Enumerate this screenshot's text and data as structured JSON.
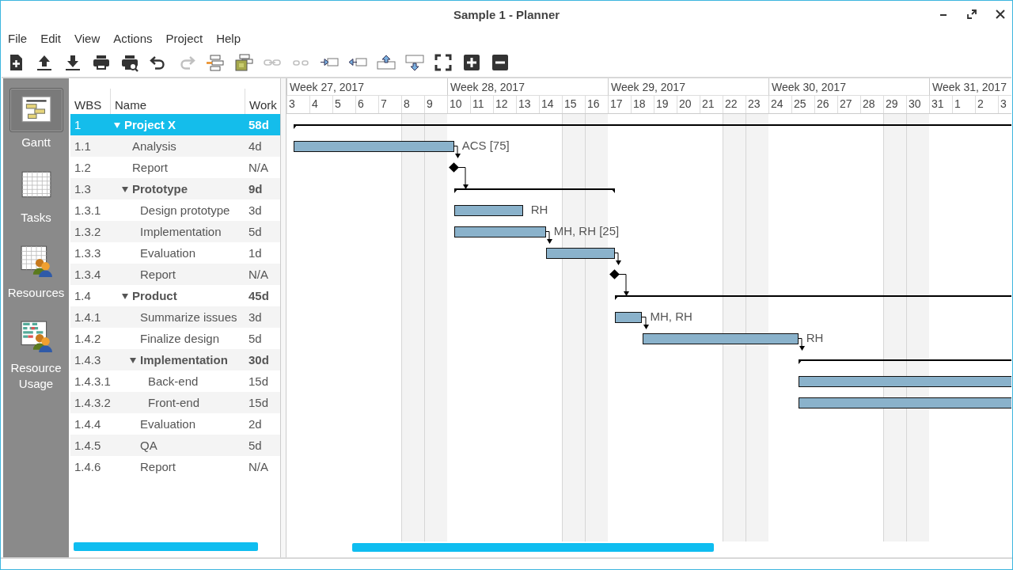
{
  "window": {
    "title": "Sample 1 - Planner"
  },
  "menu": [
    "File",
    "Edit",
    "View",
    "Actions",
    "Project",
    "Help"
  ],
  "toolbar": {
    "groups": [
      [
        {
          "kind": "new",
          "disabled": false
        },
        {
          "kind": "upload",
          "disabled": false
        },
        {
          "kind": "download",
          "disabled": false
        }
      ],
      [
        {
          "kind": "print",
          "disabled": false
        },
        {
          "kind": "preview",
          "disabled": false
        }
      ],
      [
        {
          "kind": "undo",
          "disabled": false
        },
        {
          "kind": "redo",
          "disabled": true
        }
      ],
      [
        {
          "kind": "insert-task",
          "disabled": false
        },
        {
          "kind": "insert-package",
          "disabled": false
        }
      ],
      [
        {
          "kind": "link",
          "disabled": true
        },
        {
          "kind": "unlink",
          "disabled": true
        }
      ],
      [
        {
          "kind": "indent",
          "disabled": false
        },
        {
          "kind": "unindent",
          "disabled": false
        }
      ],
      [
        {
          "kind": "move-up",
          "disabled": false
        },
        {
          "kind": "move-down",
          "disabled": false
        }
      ],
      [
        {
          "kind": "fit",
          "disabled": false
        },
        {
          "kind": "zoom-in",
          "disabled": false
        },
        {
          "kind": "zoom-out",
          "disabled": false
        }
      ]
    ]
  },
  "sidebar": {
    "items": [
      {
        "kind": "gantt",
        "label": "Gantt",
        "selected": true
      },
      {
        "kind": "tasks",
        "label": "Tasks",
        "selected": false
      },
      {
        "kind": "resources",
        "label": "Resources",
        "selected": false
      },
      {
        "kind": "usage",
        "label": "Resource Usage",
        "selected": false
      }
    ]
  },
  "task_table": {
    "columns": [
      "WBS",
      "Name",
      "Work"
    ],
    "rows": [
      {
        "wbs": "1",
        "name": "Project X",
        "work": "58d",
        "selected": true,
        "expanded": true,
        "bar": {
          "kind": "summary"
        },
        "children": [
          {
            "wbs": "1.1",
            "name": "Analysis",
            "work": "4d",
            "selected": false,
            "bar": {
              "kind": "task",
              "label": "ACS [75]",
              "link": true
            }
          },
          {
            "wbs": "1.2",
            "name": "Report",
            "work": "N/A",
            "selected": false,
            "bar": {
              "kind": "milestone",
              "link": true
            }
          },
          {
            "wbs": "1.3",
            "name": "Prototype",
            "work": "9d",
            "selected": false,
            "expanded": true,
            "bar": {
              "kind": "summary"
            },
            "children": [
              {
                "wbs": "1.3.1",
                "name": "Design prototype",
                "work": "3d",
                "selected": false,
                "bar": {
                  "kind": "task",
                  "label": "RH"
                }
              },
              {
                "wbs": "1.3.2",
                "name": "Implementation",
                "work": "5d",
                "selected": false,
                "bar": {
                  "kind": "task",
                  "label": "MH, RH [25]",
                  "link": true
                }
              },
              {
                "wbs": "1.3.3",
                "name": "Evaluation",
                "work": "1d",
                "selected": false,
                "bar": {
                  "kind": "task",
                  "link": true
                }
              },
              {
                "wbs": "1.3.4",
                "name": "Report",
                "work": "N/A",
                "selected": false,
                "bar": {
                  "kind": "milestone",
                  "link": true
                }
              }
            ]
          },
          {
            "wbs": "1.4",
            "name": "Product",
            "work": "45d",
            "selected": false,
            "expanded": true,
            "bar": {
              "kind": "summary"
            },
            "children": [
              {
                "wbs": "1.4.1",
                "name": "Summarize issues",
                "work": "3d",
                "selected": false,
                "bar": {
                  "kind": "task",
                  "label": "MH, RH",
                  "link": true
                }
              },
              {
                "wbs": "1.4.2",
                "name": "Finalize design",
                "work": "5d",
                "selected": false,
                "bar": {
                  "kind": "task",
                  "label": "RH",
                  "link": true
                }
              },
              {
                "wbs": "1.4.3",
                "name": "Implementation",
                "work": "30d",
                "selected": false,
                "expanded": true,
                "bar": {
                  "kind": "summary"
                },
                "children": [
                  {
                    "wbs": "1.4.3.1",
                    "name": "Back-end",
                    "work": "15d",
                    "selected": false,
                    "bar": {
                      "kind": "task"
                    }
                  },
                  {
                    "wbs": "1.4.3.2",
                    "name": "Front-end",
                    "work": "15d",
                    "selected": false,
                    "bar": {
                      "kind": "task"
                    }
                  }
                ]
              },
              {
                "wbs": "1.4.4",
                "name": "Evaluation",
                "work": "2d",
                "selected": false
              },
              {
                "wbs": "1.4.5",
                "name": "QA",
                "work": "5d",
                "selected": false
              },
              {
                "wbs": "1.4.6",
                "name": "Report",
                "work": "N/A",
                "selected": false
              }
            ]
          }
        ]
      }
    ]
  },
  "gantt": {
    "weeks": [
      {
        "label": "Week 27, 2017",
        "days": [
          {
            "label": "3",
            "weekend": false
          },
          {
            "label": "4",
            "weekend": false
          },
          {
            "label": "5",
            "weekend": false
          },
          {
            "label": "6",
            "weekend": false
          },
          {
            "label": "7",
            "weekend": false
          },
          {
            "label": "8",
            "weekend": true
          },
          {
            "label": "9",
            "weekend": true
          }
        ]
      },
      {
        "label": "Week 28, 2017",
        "days": [
          {
            "label": "10",
            "weekend": false
          },
          {
            "label": "11",
            "weekend": false
          },
          {
            "label": "12",
            "weekend": false
          },
          {
            "label": "13",
            "weekend": false
          },
          {
            "label": "14",
            "weekend": false
          },
          {
            "label": "15",
            "weekend": true
          },
          {
            "label": "16",
            "weekend": true
          }
        ]
      },
      {
        "label": "Week 29, 2017",
        "days": [
          {
            "label": "17",
            "weekend": false
          },
          {
            "label": "18",
            "weekend": false
          },
          {
            "label": "19",
            "weekend": false
          },
          {
            "label": "20",
            "weekend": false
          },
          {
            "label": "21",
            "weekend": false
          },
          {
            "label": "22",
            "weekend": true
          },
          {
            "label": "23",
            "weekend": true
          }
        ]
      },
      {
        "label": "Week 30, 2017",
        "days": [
          {
            "label": "24",
            "weekend": false
          },
          {
            "label": "25",
            "weekend": false
          },
          {
            "label": "26",
            "weekend": false
          },
          {
            "label": "27",
            "weekend": false
          },
          {
            "label": "28",
            "weekend": false
          },
          {
            "label": "29",
            "weekend": true
          },
          {
            "label": "30",
            "weekend": true
          }
        ]
      },
      {
        "label": "Week 31, 2017",
        "days": [
          {
            "label": "31",
            "weekend": false
          },
          {
            "label": "1",
            "weekend": false
          },
          {
            "label": "2",
            "weekend": false
          },
          {
            "label": "3",
            "weekend": false
          }
        ]
      }
    ]
  }
}
